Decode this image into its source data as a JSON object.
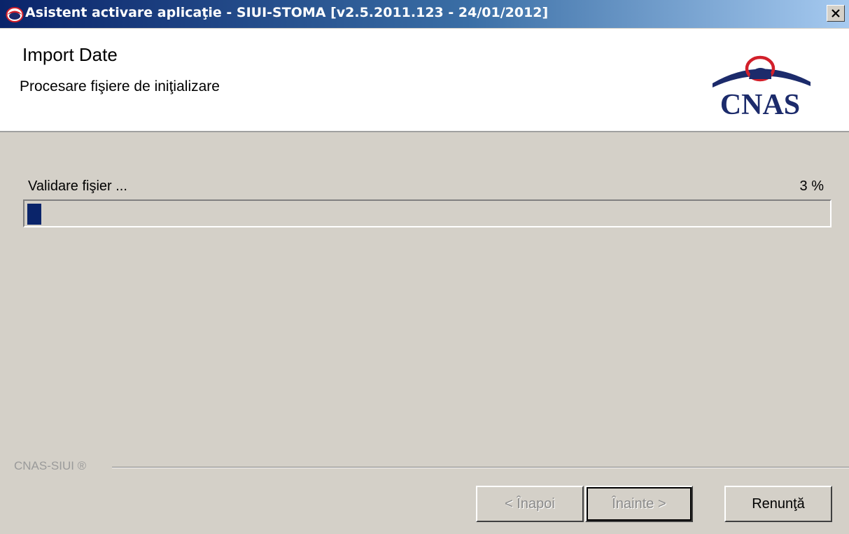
{
  "window": {
    "title": "Asistent activare aplicaţie - SIUI-STOMA [v2.5.2011.123 - 24/01/2012]",
    "close_symbol": "✕"
  },
  "header": {
    "title": "Import Date",
    "subtitle": "Procesare fişiere de iniţializare",
    "logo_text": "CNAS"
  },
  "progress": {
    "status": "Validare fişier ...",
    "percent_label": "3 %",
    "value_fraction": 0.03
  },
  "footer": {
    "brand": "CNAS-SIUI ®"
  },
  "buttons": {
    "back": "< Înapoi",
    "next": "Înainte >",
    "cancel": "Renunţă"
  },
  "colors": {
    "titlebar_start": "#0a246a",
    "titlebar_end": "#a6caf0",
    "progress_fill": "#0a246a",
    "logo_red": "#d21f2a",
    "logo_navy": "#1c2b6b"
  },
  "icons": [
    "cnas-app-icon",
    "close-icon",
    "cnas-logo"
  ]
}
